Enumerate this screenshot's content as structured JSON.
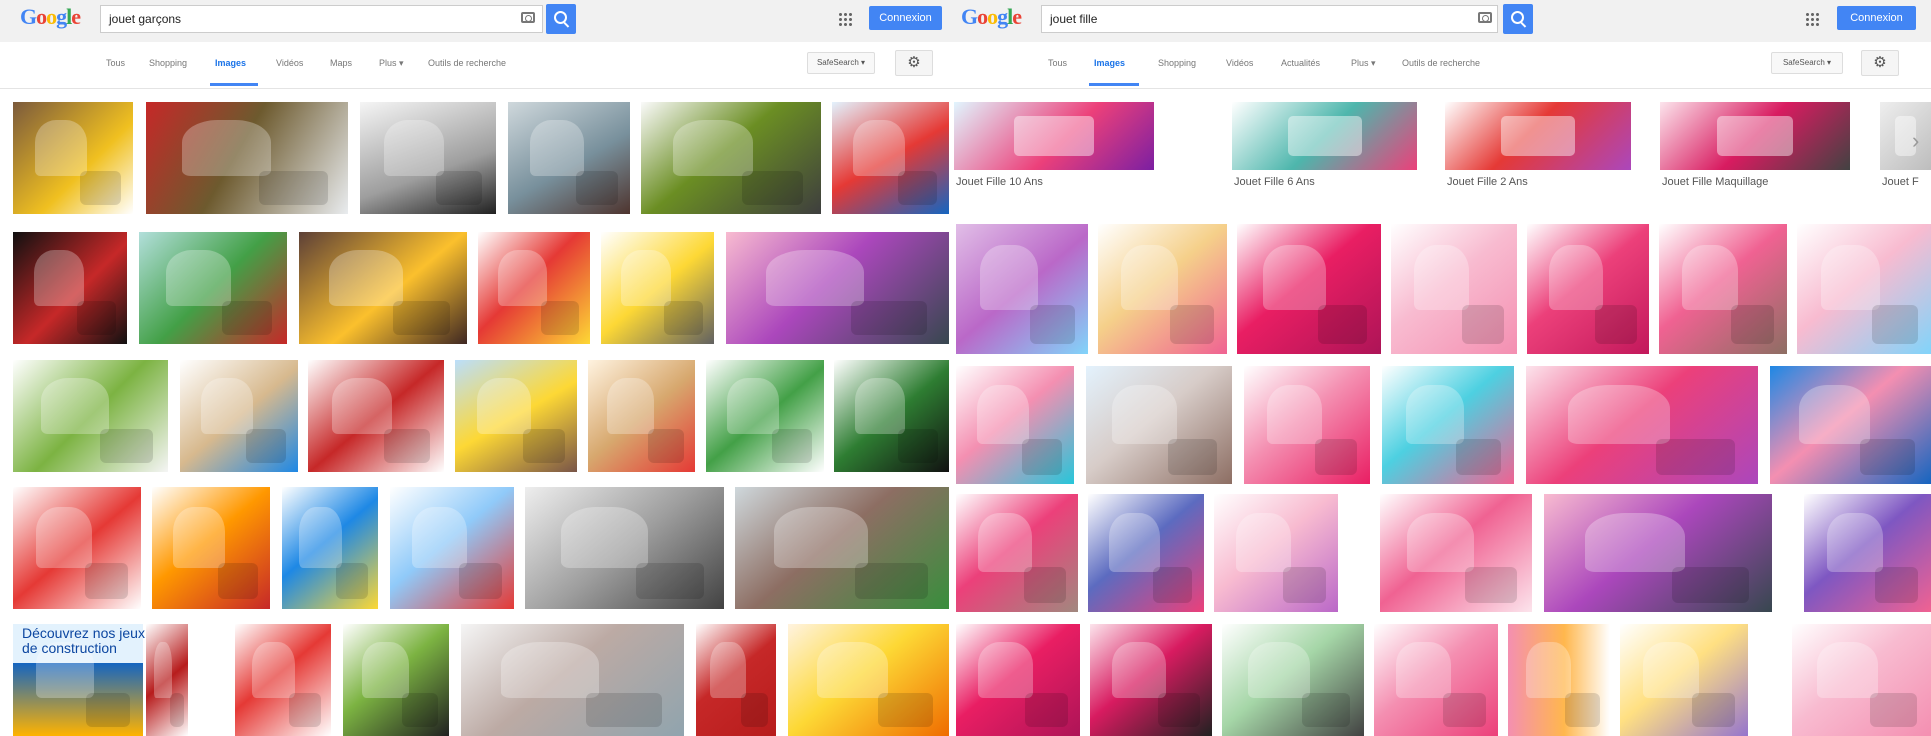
{
  "left": {
    "logo": "Google",
    "query": "jouet garçons",
    "signin_label": "Connexion",
    "tabs": [
      "Tous",
      "Shopping",
      "Images",
      "Vidéos",
      "Maps",
      "Plus ▾",
      "Outils de recherche"
    ],
    "active_tab": "Images",
    "safesearch_label": "SafeSearch ▾",
    "ad_text": "Découvrez nos jeux de construction"
  },
  "right": {
    "logo": "Google",
    "query": "jouet fille",
    "signin_label": "Connexion",
    "tabs": [
      "Tous",
      "Images",
      "Shopping",
      "Vidéos",
      "Actualités",
      "Plus ▾",
      "Outils de recherche"
    ],
    "active_tab": "Images",
    "safesearch_label": "SafeSearch ▾",
    "related": [
      "Jouet Fille 10 Ans",
      "Jouet Fille 6 Ans",
      "Jouet Fille 2 Ans",
      "Jouet Fille Maquillage",
      "Jouet F"
    ]
  },
  "icons": {
    "camera": "camera-icon",
    "search": "search-icon",
    "apps": "apps-grid-icon",
    "settings": "gear-icon",
    "next": "chevron-right-icon"
  },
  "colors": {
    "accent": "#4285f4",
    "pink": "#e7298a"
  }
}
